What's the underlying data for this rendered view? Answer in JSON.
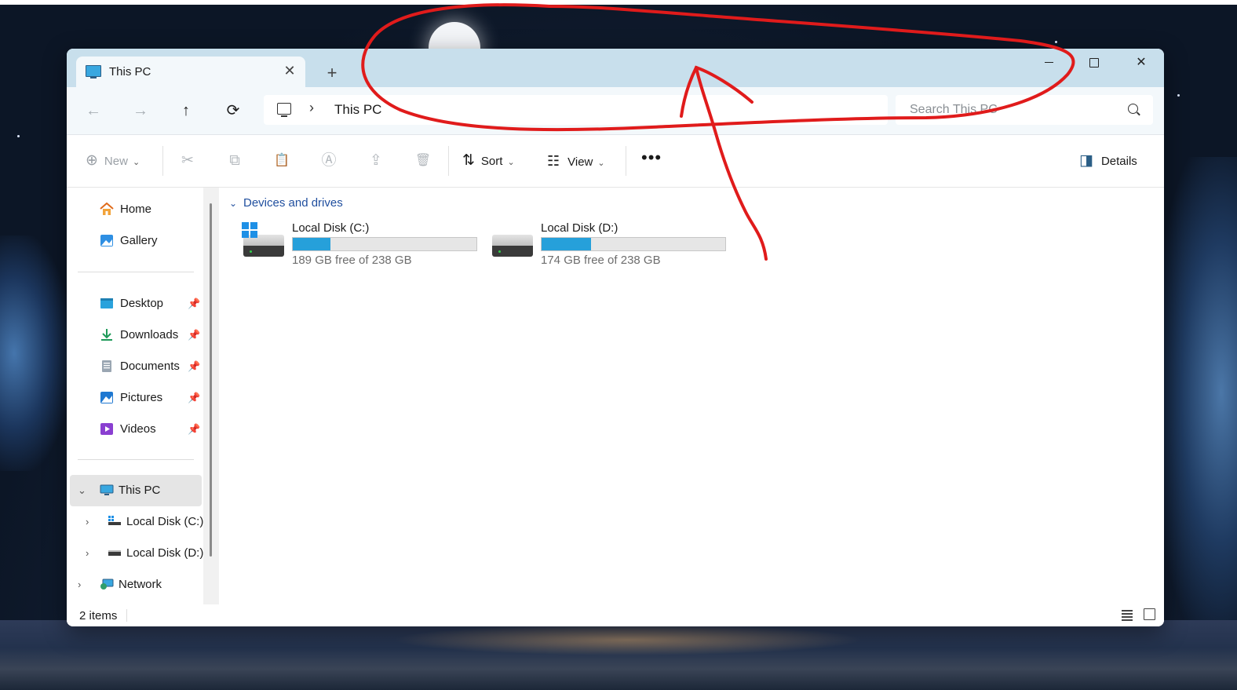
{
  "window": {
    "tab_title": "This PC",
    "tab_close_glyph": "✕",
    "new_tab_glyph": "+",
    "close_glyph": "✕"
  },
  "nav": {
    "back_glyph": "←",
    "forward_glyph": "→",
    "up_glyph": "↑",
    "refresh_glyph": "⟳",
    "breadcrumb_separator": "›",
    "breadcrumb": "This PC",
    "search_placeholder": "Search This PC"
  },
  "toolbar": {
    "new_label": "New",
    "new_glyph": "⊕",
    "cut_glyph": "✂",
    "copy_glyph": "⧉",
    "paste_glyph": "📋",
    "rename_glyph": "Ⓐ",
    "share_glyph": "⇪",
    "delete_glyph": "🗑",
    "sort_label": "Sort",
    "sort_glyph": "⇅",
    "view_label": "View",
    "view_glyph": "☷",
    "more_glyph": "•••",
    "details_label": "Details",
    "details_glyph": "◨",
    "dropdown_glyph": "⌄"
  },
  "sidebar": {
    "home": "Home",
    "gallery": "Gallery",
    "quick_access": [
      {
        "label": "Desktop",
        "icon": "desktop-folder-icon"
      },
      {
        "label": "Downloads",
        "icon": "downloads-folder-icon"
      },
      {
        "label": "Documents",
        "icon": "documents-folder-icon"
      },
      {
        "label": "Pictures",
        "icon": "pictures-folder-icon"
      },
      {
        "label": "Videos",
        "icon": "videos-folder-icon"
      }
    ],
    "pin_glyph": "📌",
    "this_pc": "This PC",
    "drive_c": "Local Disk (C:)",
    "drive_d": "Local Disk (D:)",
    "network": "Network",
    "expanded_glyph": "⌄",
    "collapsed_glyph": "›"
  },
  "content": {
    "group_header": "Devices and drives",
    "group_chevron": "⌄",
    "drives": [
      {
        "name": "Local Disk (C:)",
        "free_text": "189 GB free of 238 GB",
        "used_fraction": 0.206,
        "has_windows_logo": true
      },
      {
        "name": "Local Disk (D:)",
        "free_text": "174 GB free of 238 GB",
        "used_fraction": 0.269,
        "has_windows_logo": false
      }
    ]
  },
  "status": {
    "item_count": "2 items"
  },
  "colors": {
    "titlebar": "#c8dfec",
    "accent": "#26a0da",
    "annotation": "#e01b1b"
  }
}
